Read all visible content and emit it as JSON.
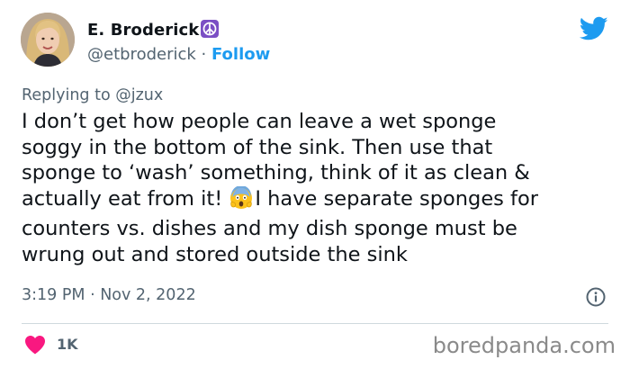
{
  "author": {
    "display_name": "E. Broderick",
    "handle": "@etbroderick",
    "separator": " · ",
    "follow_label": "Follow",
    "name_emoji": "peace-symbol-emoji",
    "avatar": "avatar-photo"
  },
  "reply": {
    "prefix": "Replying to ",
    "mention": "@jzux"
  },
  "tweet": {
    "lines": [
      "I don’t get how people can leave a wet sponge",
      "soggy in the bottom of the sink. Then use that",
      "sponge to ‘wash’ something, think of it as clean &",
      "actually eat from it! ",
      "I have separate sponges for",
      "counters vs. dishes and my dish sponge must be",
      "wrung out and stored outside the sink"
    ],
    "inline_emoji": "face-screaming-in-fear-emoji"
  },
  "meta": {
    "timestamp": "3:19 PM · Nov 2, 2022",
    "info_icon": "info-icon"
  },
  "engagement": {
    "likes": "1K",
    "like_icon": "heart-icon"
  },
  "brand": {
    "logo": "twitter-bird-icon",
    "logo_color": "#1d9bf0",
    "watermark": "boredpanda.com"
  },
  "colors": {
    "accent": "#1d9bf0",
    "heart": "#f91880",
    "secondary_text": "#536471",
    "primary_text": "#0f1419",
    "peace_purple": "#7b4fc4"
  }
}
